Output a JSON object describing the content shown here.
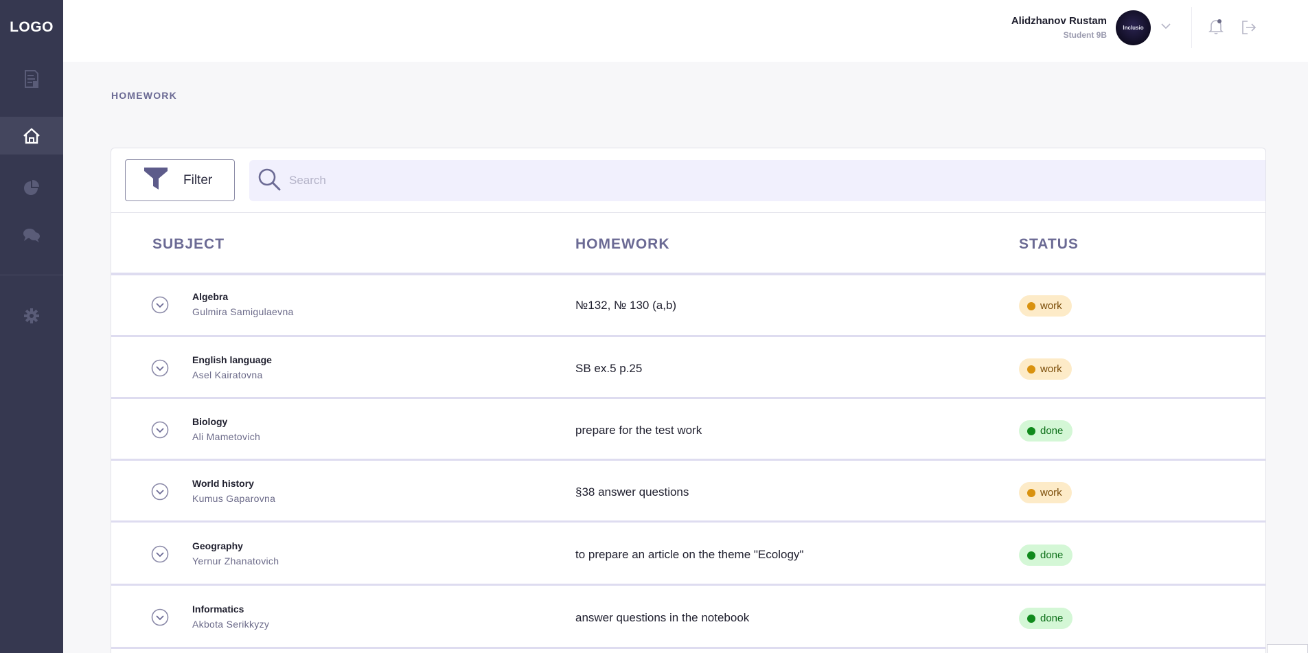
{
  "sidebar": {
    "logo": "LOGO",
    "items": [
      {
        "icon": "document-icon",
        "active": false
      },
      {
        "icon": "home-icon",
        "active": true
      },
      {
        "icon": "pie-chart-icon",
        "active": false
      },
      {
        "icon": "chat-icon",
        "active": false
      },
      {
        "icon": "gear-icon",
        "active": false
      }
    ]
  },
  "header": {
    "user_name": "Alidzhanov Rustam",
    "user_role": "Student 9B",
    "avatar_text": "Inclusio"
  },
  "page": {
    "title": "HOMEWORK"
  },
  "toolbar": {
    "filter_label": "Filter",
    "search_placeholder": "Search"
  },
  "table": {
    "columns": [
      "SUBJECT",
      "HOMEWORK",
      "STATUS"
    ],
    "rows": [
      {
        "subject": "Algebra",
        "teacher": "Gulmira Samigulaevna",
        "homework": "№132, № 130 (a,b)",
        "status": "work"
      },
      {
        "subject": "English language",
        "teacher": "Asel Kairatovna",
        "homework": "SB ex.5 p.25",
        "status": "work"
      },
      {
        "subject": "Biology",
        "teacher": "Ali Mametovich",
        "homework": "prepare for the test work",
        "status": "done"
      },
      {
        "subject": "World history",
        "teacher": "Kumus Gaparovna",
        "homework": "§38 answer questions",
        "status": "work"
      },
      {
        "subject": "Geography",
        "teacher": "Yernur Zhanatovich",
        "homework": "to prepare an article on the theme \"Ecology\"",
        "status": "done"
      },
      {
        "subject": "Informatics",
        "teacher": "Akbota Serikkyzy",
        "homework": "answer questions in the notebook",
        "status": "done"
      }
    ]
  },
  "colors": {
    "sidebar_bg": "#363850",
    "accent": "#6b6a94",
    "work_bg": "#fdebc8",
    "work_dot": "#d9920f",
    "done_bg": "#d4f7d6",
    "done_dot": "#108a1c"
  }
}
